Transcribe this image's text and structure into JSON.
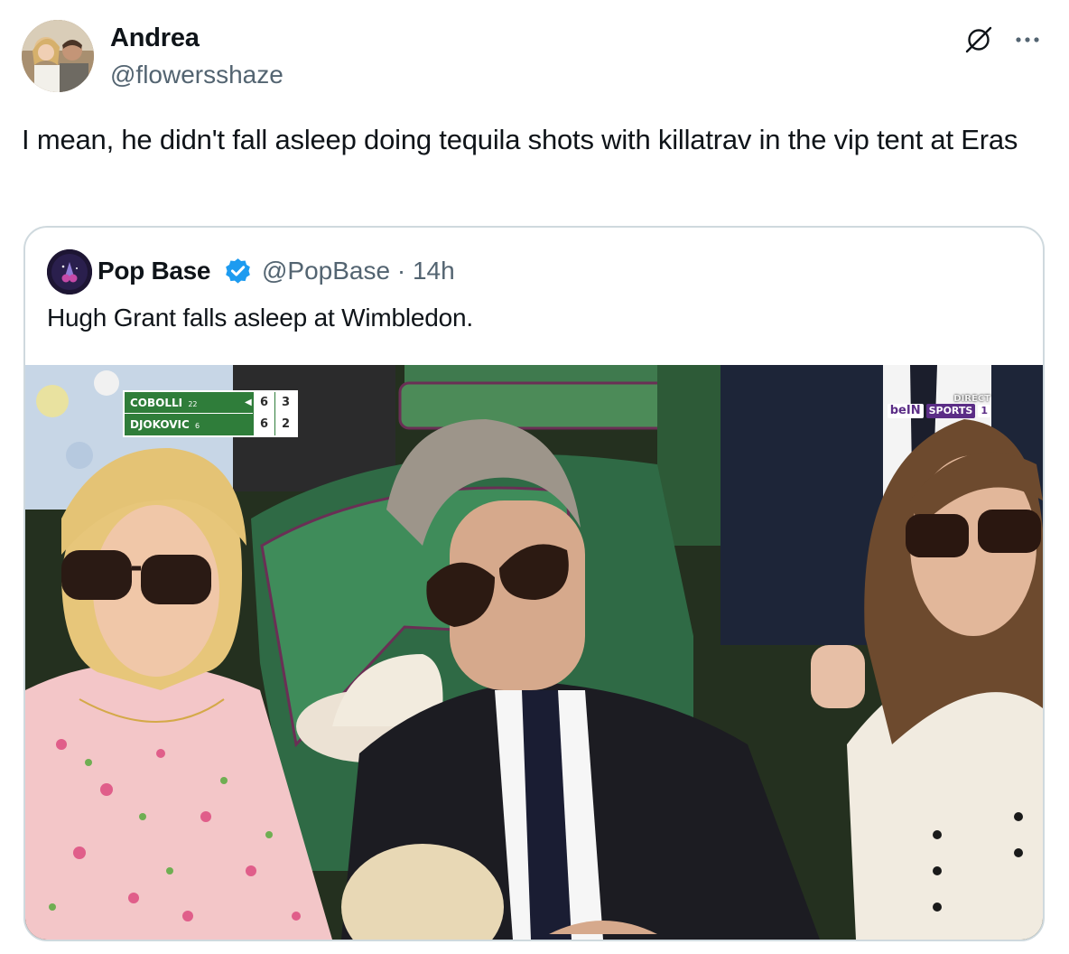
{
  "post": {
    "author_name": "Andrea",
    "author_handle": "@flowersshaze",
    "text": "I mean, he didn't fall asleep doing tequila shots with killatrav in the vip tent at Eras",
    "grok_icon": "grok-icon",
    "more_icon": "more-dots-icon"
  },
  "quoted_post": {
    "author_name": "Pop Base",
    "verified": true,
    "verified_color": "#1d9bf0",
    "handle_time": "@PopBase · 14h",
    "text": "Hugh Grant falls asleep at Wimbledon."
  },
  "media": {
    "scoreboard": {
      "players": [
        {
          "name": "COBOLLI",
          "rank": "22",
          "set1": "6",
          "set2": "3",
          "serving": true
        },
        {
          "name": "DJOKOVIC",
          "rank": "6",
          "set1": "6",
          "set2": "2",
          "serving": false
        }
      ],
      "serve_mark": "◀"
    },
    "broadcaster": {
      "direct": "DIRECT",
      "brand": "beIN",
      "sports": "SPORTS",
      "channel": "1"
    }
  }
}
